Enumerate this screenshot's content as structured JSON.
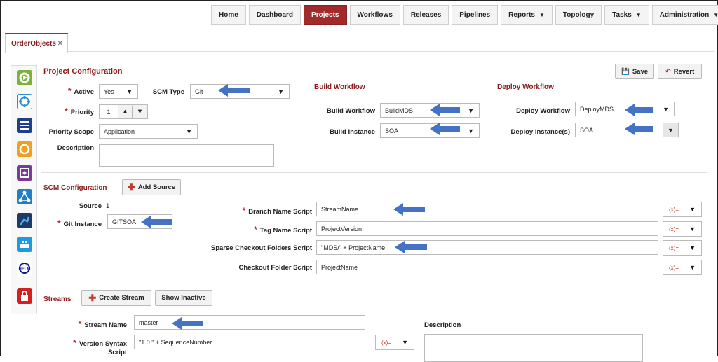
{
  "nav": {
    "items": [
      {
        "label": "Home"
      },
      {
        "label": "Dashboard"
      },
      {
        "label": "Projects",
        "active": true
      },
      {
        "label": "Workflows"
      },
      {
        "label": "Releases"
      },
      {
        "label": "Pipelines"
      },
      {
        "label": "Reports",
        "caret": "▼"
      },
      {
        "label": "Topology"
      },
      {
        "label": "Tasks",
        "caret": "▼"
      },
      {
        "label": "Administration",
        "caret": "▼"
      }
    ],
    "accent": "#a32a2a"
  },
  "tab": {
    "label": "OrderObjects",
    "close": "✕"
  },
  "toolbar": {
    "save": "Save",
    "revert": "Revert"
  },
  "project_config": {
    "title": "Project Configuration",
    "active_label": "Active",
    "active_value": "Yes",
    "scm_type_label": "SCM Type",
    "scm_type_value": "Git",
    "priority_label": "Priority",
    "priority_value": "1",
    "priority_scope_label": "Priority Scope",
    "priority_scope_value": "Application",
    "description_label": "Description",
    "description_value": ""
  },
  "build_workflow": {
    "title": "Build Workflow",
    "workflow_label": "Build Workflow",
    "workflow_value": "BuildMDS",
    "instance_label": "Build Instance",
    "instance_value": "SOA"
  },
  "deploy_workflow": {
    "title": "Deploy Workflow",
    "workflow_label": "Deploy Workflow",
    "workflow_value": "DeployMDS",
    "instance_label": "Deploy Instance(s)",
    "instance_value": "SOA"
  },
  "scm_config": {
    "title": "SCM Configuration",
    "add_source": "Add Source",
    "source_label": "Source",
    "source_value": "1",
    "git_instance_label": "Git Instance",
    "git_instance_value": "GITSOA",
    "branch_label": "Branch Name Script",
    "branch_value": "StreamName",
    "tag_label": "Tag Name Script",
    "tag_value": "ProjectVersion",
    "sparse_label": "Sparse Checkout Folders Script",
    "sparse_value": "\"MDS/\" + ProjectName",
    "checkout_label": "Checkout Folder Script",
    "checkout_value": "ProjectName",
    "fx_text": "(x)="
  },
  "streams": {
    "title": "Streams",
    "create": "Create Stream",
    "show_inactive": "Show Inactive",
    "name_label": "Stream Name",
    "name_value": "master",
    "version_label": "Version Syntax",
    "version_label2": "Script",
    "version_value": "\"1.0.\" + SequenceNumber",
    "description_label": "Description"
  },
  "icons": {
    "arrow_color": "#4472c4",
    "sidebar": [
      "settings-icon",
      "network-icon",
      "list-icon",
      "refresh-icon",
      "component-icon",
      "topology-icon",
      "robot-icon",
      "docker-icon",
      "helm-icon",
      "lock-icon"
    ]
  }
}
